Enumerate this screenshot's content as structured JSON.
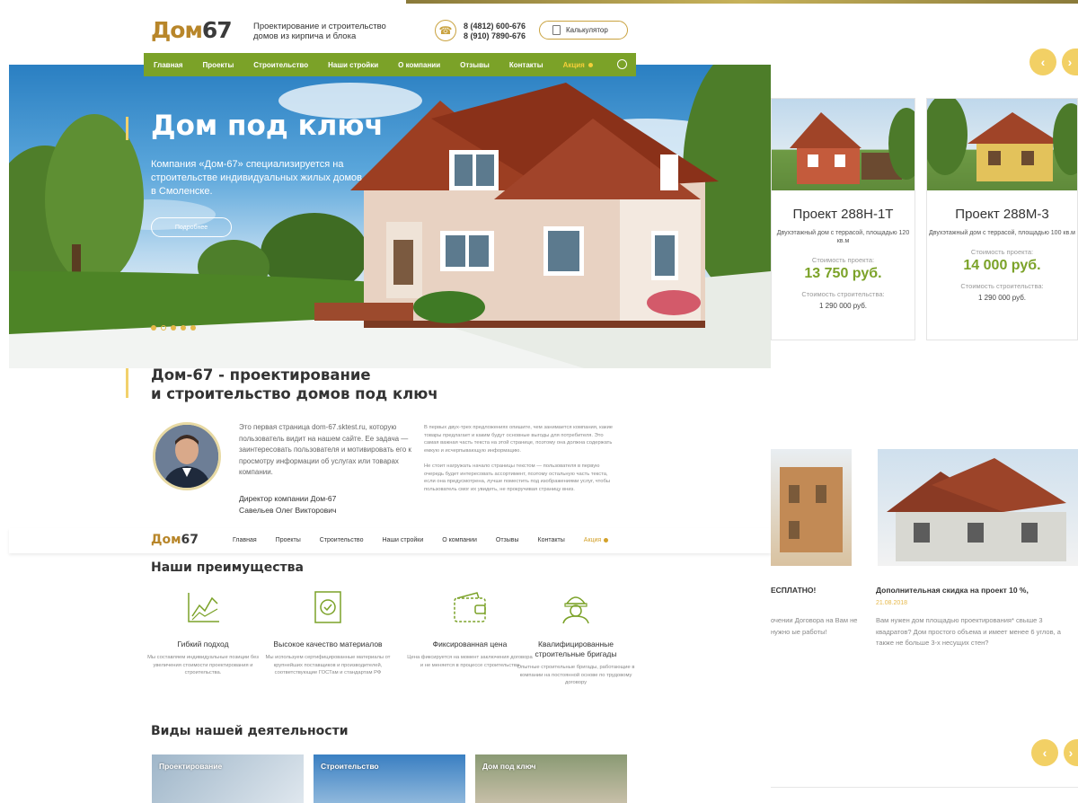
{
  "header": {
    "logo_a": "Дом",
    "logo_b": "67",
    "tagline": "Проектирование и строительство домов из кирпича и блока",
    "phone1": "8 (4812) 600-676",
    "phone2": "8 (910) 7890-676",
    "calc_label": "Калькулятор"
  },
  "nav": {
    "items": [
      "Главная",
      "Проекты",
      "Строительство",
      "Наши стройки",
      "О компании",
      "Отзывы",
      "Контакты"
    ],
    "promo": "Акция"
  },
  "hero": {
    "title": "Дом под ключ",
    "text": "Компания «Дом-67» специализируется на строительстве индивидуальных жилых домов  в Смоленске.",
    "button": "Подробнее"
  },
  "projects": [
    {
      "title": "Проект 288Н-1Т",
      "desc": "Двухэтажный дом с террасой, площадью 120 кв.м",
      "price_label": "Стоимость проекта:",
      "price": "13 750 руб.",
      "build_label": "Стоимость строительства:",
      "build_price": "1 290 000 руб."
    },
    {
      "title": "Проект 288М-3",
      "desc": "Двухэтажный дом с террасой, площадью 100 кв.м",
      "price_label": "Стоимость проекта:",
      "price": "14 000 руб.",
      "build_label": "Стоимость строительства:",
      "build_price": "1 290 000 руб."
    }
  ],
  "intro": {
    "title_line1": "Дом-67 - проектирование",
    "title_line2": "и строительство домов под ключ",
    "paragraph": "Это первая страница dom-67.sktest.ru, которую пользователь видит на нашем сайте. Ее задача — заинтересовать пользователя и мотивировать его к просмотру информации об услугах или товарах компании.",
    "sign_role": "Директор компании Дом-67",
    "sign_name": "Савельев Олег Викторович",
    "right_p1": "В первых двух-трех предложениях опишите, чем занимается компания, какие товары предлагает и каким будут основные выгоды для потребителя. Это самая важная часть текста на этой странице, поэтому она должна содержать емкую и исчерпывающую информацию.",
    "right_p2": "Не стоит нагружать начало страницы текстом — пользователя в первую очередь будет интересовать ассортимент, поэтому остальную часть текста, если она предусмотрена, лучше поместить под изображениями услуг, чтобы пользователь смог их увидеть, не прокручивая страницу вниз."
  },
  "nav2": {
    "logo_a": "Дом",
    "logo_b": "67",
    "items": [
      "Главная",
      "Проекты",
      "Строительство",
      "Наши стройки",
      "О компании",
      "Отзывы",
      "Контакты"
    ],
    "promo": "Акция"
  },
  "advantages": {
    "title": "Наши преимущества",
    "items": [
      {
        "icon": "chart-icon",
        "title": "Гибкий подход",
        "desc": "Мы составляем индивидуальные позиции без увеличения стоимости проектирования и строительства."
      },
      {
        "icon": "certificate-icon",
        "title": "Высокое качество материалов",
        "desc": "Мы используем сертифицированные материалы от крупнейших поставщиков и производителей, соответствующие ГОСТам и стандартам РФ"
      },
      {
        "icon": "wallet-icon",
        "title": "Фиксированная цена",
        "desc": "Цена фиксируется на момент заключения договора и не меняется в процессе строительства"
      },
      {
        "icon": "worker-icon",
        "title": "Квалифицированные строительные бригады",
        "desc": "Опытные строительные бригады, работающие в компании на постоянной основе по трудовому договору"
      }
    ]
  },
  "activities": {
    "title": "Виды нашей деятельности",
    "tiles": [
      "Проектирование",
      "Строительство",
      "Дом под ключ"
    ]
  },
  "news": [
    {
      "title": "ЕСПЛАТНО!",
      "date": "",
      "text": "очении Договора на Вам не нужно ые работы!"
    },
    {
      "title": "Дополнительная скидка на проект 10 %,",
      "date": "21.08.2018",
      "text": "Вам нужен дом площадью проектирования* свыше 3 квадратов? Дом простого объема и имеет менее 6 углов, а также не больше 3-х несущих стен?"
    }
  ],
  "colors": {
    "accent": "#7ba228",
    "gold": "#e6b84a"
  }
}
